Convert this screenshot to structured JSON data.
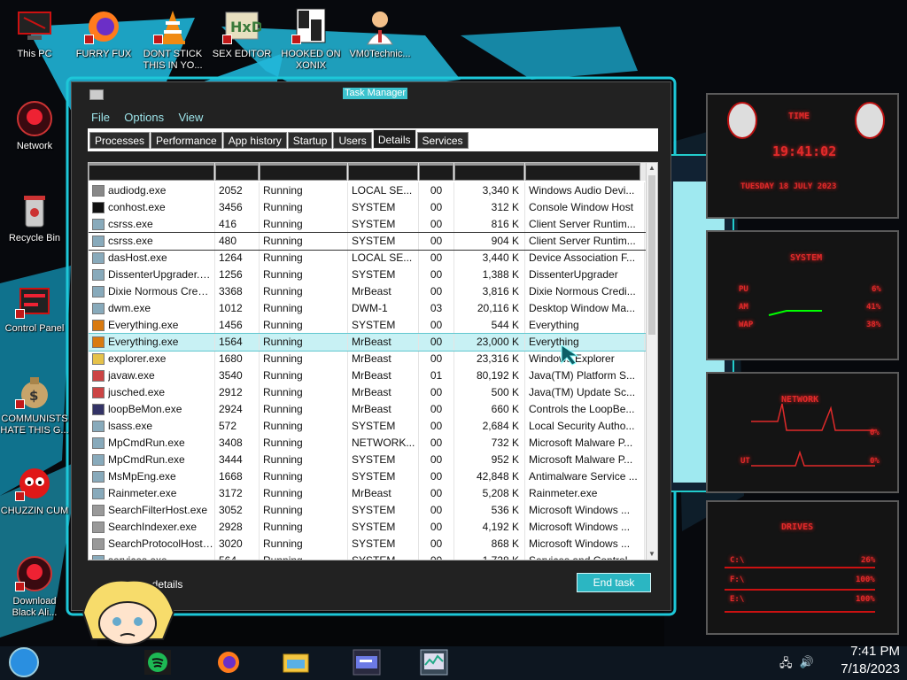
{
  "desktop_icons": [
    {
      "label": "This PC"
    },
    {
      "label": "FURRY FUX"
    },
    {
      "label": "DONT STICK THIS IN YO..."
    },
    {
      "label": "SEX EDITOR"
    },
    {
      "label": "HOOKED ON XONIX"
    },
    {
      "label": "VM0Technic..."
    },
    {
      "label": "Network"
    },
    {
      "label": "Recycle Bin"
    },
    {
      "label": "Control Panel"
    },
    {
      "label": "COMMUNISTS HATE THIS G..."
    },
    {
      "label": "CHUZZIN CUM"
    },
    {
      "label": "Download Black Ali..."
    }
  ],
  "task_manager": {
    "title": "Task Manager",
    "menu": [
      "File",
      "Options",
      "View"
    ],
    "tabs": [
      "Processes",
      "Performance",
      "App history",
      "Startup",
      "Users",
      "Details",
      "Services"
    ],
    "active_tab": "Details",
    "processes": [
      {
        "name": "audiodg.exe",
        "pid": "2052",
        "status": "Running",
        "user": "LOCAL SE...",
        "cpu": "00",
        "mem": "3,340 K",
        "desc": "Windows Audio Devi..."
      },
      {
        "name": "conhost.exe",
        "pid": "3456",
        "status": "Running",
        "user": "SYSTEM",
        "cpu": "00",
        "mem": "312 K",
        "desc": "Console Window Host"
      },
      {
        "name": "csrss.exe",
        "pid": "416",
        "status": "Running",
        "user": "SYSTEM",
        "cpu": "00",
        "mem": "816 K",
        "desc": "Client Server Runtim..."
      },
      {
        "name": "csrss.exe",
        "pid": "480",
        "status": "Running",
        "user": "SYSTEM",
        "cpu": "00",
        "mem": "904 K",
        "desc": "Client Server Runtim..."
      },
      {
        "name": "dasHost.exe",
        "pid": "1264",
        "status": "Running",
        "user": "LOCAL SE...",
        "cpu": "00",
        "mem": "3,440 K",
        "desc": "Device Association F..."
      },
      {
        "name": "DissenterUpgrader.exe",
        "pid": "1256",
        "status": "Running",
        "user": "SYSTEM",
        "cpu": "00",
        "mem": "1,388 K",
        "desc": "DissenterUpgrader"
      },
      {
        "name": "Dixie Normous Credi...",
        "pid": "3368",
        "status": "Running",
        "user": "MrBeast",
        "cpu": "00",
        "mem": "3,816 K",
        "desc": "Dixie Normous Credi..."
      },
      {
        "name": "dwm.exe",
        "pid": "1012",
        "status": "Running",
        "user": "DWM-1",
        "cpu": "03",
        "mem": "20,116 K",
        "desc": "Desktop Window Ma..."
      },
      {
        "name": "Everything.exe",
        "pid": "1456",
        "status": "Running",
        "user": "SYSTEM",
        "cpu": "00",
        "mem": "544 K",
        "desc": "Everything"
      },
      {
        "name": "Everything.exe",
        "pid": "1564",
        "status": "Running",
        "user": "MrBeast",
        "cpu": "00",
        "mem": "23,000 K",
        "desc": "Everything"
      },
      {
        "name": "explorer.exe",
        "pid": "1680",
        "status": "Running",
        "user": "MrBeast",
        "cpu": "00",
        "mem": "23,316 K",
        "desc": "Windows Explorer"
      },
      {
        "name": "javaw.exe",
        "pid": "3540",
        "status": "Running",
        "user": "MrBeast",
        "cpu": "01",
        "mem": "80,192 K",
        "desc": "Java(TM) Platform S..."
      },
      {
        "name": "jusched.exe",
        "pid": "2912",
        "status": "Running",
        "user": "MrBeast",
        "cpu": "00",
        "mem": "500 K",
        "desc": "Java(TM) Update Sc..."
      },
      {
        "name": "loopBeMon.exe",
        "pid": "2924",
        "status": "Running",
        "user": "MrBeast",
        "cpu": "00",
        "mem": "660 K",
        "desc": "Controls the LoopBe..."
      },
      {
        "name": "lsass.exe",
        "pid": "572",
        "status": "Running",
        "user": "SYSTEM",
        "cpu": "00",
        "mem": "2,684 K",
        "desc": "Local Security Autho..."
      },
      {
        "name": "MpCmdRun.exe",
        "pid": "3408",
        "status": "Running",
        "user": "NETWORK...",
        "cpu": "00",
        "mem": "732 K",
        "desc": "Microsoft Malware P..."
      },
      {
        "name": "MpCmdRun.exe",
        "pid": "3444",
        "status": "Running",
        "user": "SYSTEM",
        "cpu": "00",
        "mem": "952 K",
        "desc": "Microsoft Malware P..."
      },
      {
        "name": "MsMpEng.exe",
        "pid": "1668",
        "status": "Running",
        "user": "SYSTEM",
        "cpu": "00",
        "mem": "42,848 K",
        "desc": "Antimalware Service ..."
      },
      {
        "name": "Rainmeter.exe",
        "pid": "3172",
        "status": "Running",
        "user": "MrBeast",
        "cpu": "00",
        "mem": "5,208 K",
        "desc": "Rainmeter.exe"
      },
      {
        "name": "SearchFilterHost.exe",
        "pid": "3052",
        "status": "Running",
        "user": "SYSTEM",
        "cpu": "00",
        "mem": "536 K",
        "desc": "Microsoft Windows ..."
      },
      {
        "name": "SearchIndexer.exe",
        "pid": "2928",
        "status": "Running",
        "user": "SYSTEM",
        "cpu": "00",
        "mem": "4,192 K",
        "desc": "Microsoft Windows ..."
      },
      {
        "name": "SearchProtocolHost....",
        "pid": "3020",
        "status": "Running",
        "user": "SYSTEM",
        "cpu": "00",
        "mem": "868 K",
        "desc": "Microsoft Windows ..."
      },
      {
        "name": "services.exe",
        "pid": "564",
        "status": "Running",
        "user": "SYSTEM",
        "cpu": "00",
        "mem": "1,728 K",
        "desc": "Services and Control..."
      }
    ],
    "fewer_details": "Fewer details",
    "end_task": "End task"
  },
  "widgets": {
    "time_title": "TIME",
    "time": "19:41:02",
    "date": "TUESDAY 18 JULY 2023",
    "system_title": "SYSTEM",
    "cpu_label": "PU",
    "cpu_value": "6%",
    "ram_label": "AM",
    "ram_value": "41%",
    "swap_label": "WAP",
    "swap_value": "38%",
    "network_title": "NETWORK",
    "net_in": "0%",
    "net_out_label": "UT",
    "net_out": "0%",
    "drives_title": "DRIVES",
    "drives": [
      {
        "label": "C:\\",
        "value": "26%"
      },
      {
        "label": "F:\\",
        "value": "100%"
      },
      {
        "label": "E:\\",
        "value": "100%"
      }
    ]
  },
  "taskbar": {
    "time": "7:41 PM",
    "date": "7/18/2023",
    "icons": [
      "start-orb-icon",
      "spotify-icon",
      "firefox-icon",
      "file-explorer-icon",
      "control-panel-icon",
      "task-manager-icon"
    ]
  },
  "colors": {
    "accent": "#2bb6c2",
    "widget_red": "#e02a2a",
    "selection": "#c8f1f4"
  }
}
